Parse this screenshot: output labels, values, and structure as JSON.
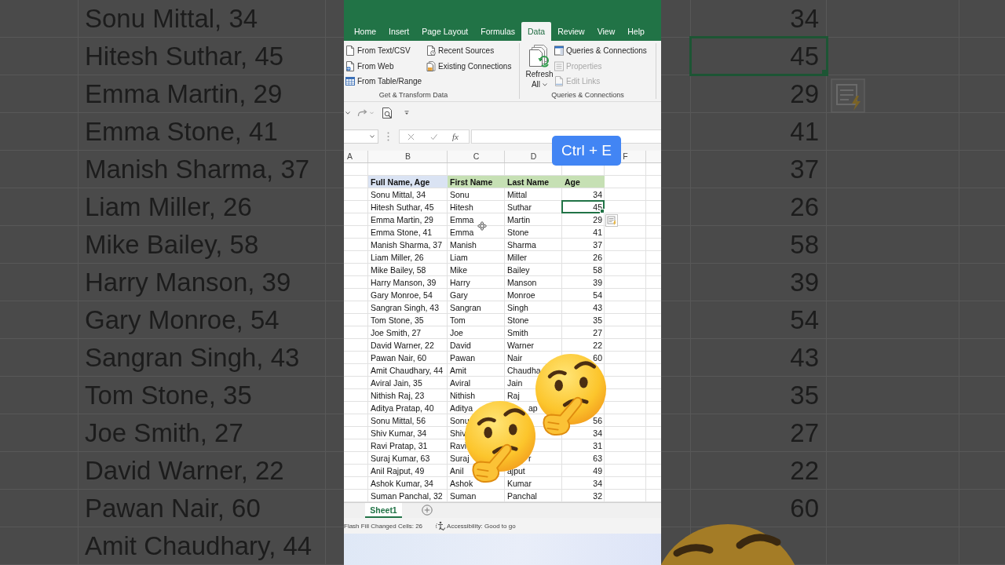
{
  "backdrop_left": {
    "rows": [
      "Sonu Mittal, 34",
      "Hitesh Suthar, 45",
      "Emma Martin, 29",
      "Emma Stone, 41",
      "Manish Sharma, 37",
      "Liam Miller, 26",
      "Mike Bailey, 58",
      "Harry Manson, 39",
      "Gary Monroe, 54",
      "Sangran Singh, 43",
      "Tom Stone, 35",
      "Joe Smith, 27",
      "David Warner, 22",
      "Pawan Nair, 60",
      "Amit Chaudhary, 44"
    ]
  },
  "ribbon": {
    "tabs": [
      {
        "label": "Home",
        "selected": false
      },
      {
        "label": "Insert",
        "selected": false
      },
      {
        "label": "Page Layout",
        "selected": false
      },
      {
        "label": "Formulas",
        "selected": false
      },
      {
        "label": "Data",
        "selected": true
      },
      {
        "label": "Review",
        "selected": false
      },
      {
        "label": "View",
        "selected": false
      },
      {
        "label": "Help",
        "selected": false
      }
    ],
    "groups": [
      {
        "title": "Get & Transform Data",
        "columns": [
          [
            {
              "label": "From Text/CSV",
              "disabled": false
            },
            {
              "label": "From Web",
              "disabled": false
            },
            {
              "label": "From Table/Range",
              "disabled": false
            }
          ],
          [
            {
              "label": "Recent Sources",
              "disabled": false
            },
            {
              "label": "Existing Connections",
              "disabled": false
            }
          ]
        ]
      },
      {
        "title": "Queries & Connections",
        "large_button": {
          "label": "Refresh",
          "sublabel": "All"
        },
        "columns": [
          [
            {
              "label": "Queries & Connections",
              "disabled": false
            },
            {
              "label": "Properties",
              "disabled": true
            },
            {
              "label": "Edit Links",
              "disabled": true
            }
          ]
        ]
      }
    ]
  },
  "formula_bar": {
    "function_label": "fx"
  },
  "shortcut_badge": {
    "text": "Ctrl + E"
  },
  "sheet": {
    "column_headers": [
      "A",
      "B",
      "C",
      "D",
      "F"
    ],
    "table_header": [
      {
        "label": "Full Name, Age",
        "color": "#dae3f3"
      },
      {
        "label": "First Name",
        "color": "#c6e0b4"
      },
      {
        "label": "Last Name",
        "color": "#c6e0b4"
      },
      {
        "label": "Age",
        "color": "#c6e0b4"
      }
    ],
    "rows": [
      {
        "full": "Sonu Mittal, 34",
        "first": "Sonu",
        "last": "Mittal",
        "age": "34",
        "age_selected": false
      },
      {
        "full": "Hitesh Suthar, 45",
        "first": "Hitesh",
        "last": "Suthar",
        "age": "45",
        "age_selected": true
      },
      {
        "full": "Emma Martin, 29",
        "first": "Emma",
        "last": "Martin",
        "age": "29",
        "age_selected": false
      },
      {
        "full": "Emma Stone, 41",
        "first": "Emma",
        "last": "Stone",
        "age": "41",
        "age_selected": false
      },
      {
        "full": "Manish Sharma, 37",
        "first": "Manish",
        "last": "Sharma",
        "age": "37",
        "age_selected": false
      },
      {
        "full": "Liam Miller, 26",
        "first": "Liam",
        "last": "Miller",
        "age": "26",
        "age_selected": false
      },
      {
        "full": "Mike Bailey, 58",
        "first": "Mike",
        "last": "Bailey",
        "age": "58",
        "age_selected": false
      },
      {
        "full": "Harry Manson, 39",
        "first": "Harry",
        "last": "Manson",
        "age": "39",
        "age_selected": false
      },
      {
        "full": "Gary Monroe, 54",
        "first": "Gary",
        "last": "Monroe",
        "age": "54",
        "age_selected": false
      },
      {
        "full": "Sangran Singh, 43",
        "first": "Sangran",
        "last": "Singh",
        "age": "43",
        "age_selected": false
      },
      {
        "full": "Tom Stone, 35",
        "first": "Tom",
        "last": "Stone",
        "age": "35",
        "age_selected": false
      },
      {
        "full": "Joe Smith, 27",
        "first": "Joe",
        "last": "Smith",
        "age": "27",
        "age_selected": false
      },
      {
        "full": "David Warner, 22",
        "first": "David",
        "last": "Warner",
        "age": "22",
        "age_selected": false
      },
      {
        "full": "Pawan Nair, 60",
        "first": "Pawan",
        "last": "Nair",
        "age": "60",
        "age_selected": false
      },
      {
        "full": "Amit Chaudhary, 44",
        "first": "Amit",
        "last": "Chaudha",
        "age_selected": false
      },
      {
        "full": "Aviral Jain, 35",
        "first": "Aviral",
        "last": "Jain",
        "age_selected": false
      },
      {
        "full": "Nithish Raj, 23",
        "first": "Nithish",
        "last": "Raj",
        "age_selected": false
      },
      {
        "full": "Aditya Pratap, 40",
        "first": "Aditya",
        "last_tail": "ap",
        "age_selected": false
      },
      {
        "full": "Sonu Mittal, 56",
        "first": "Sonu",
        "age": "56",
        "age_selected": false
      },
      {
        "full": "Shiv Kumar, 34",
        "first": "Shiv",
        "age": "34",
        "age_selected": false
      },
      {
        "full": "Ravi Pratap, 31",
        "first": "Ravi",
        "age": "31",
        "age_selected": false
      },
      {
        "full": "Suraj Kumar, 63",
        "first": "Suraj",
        "last_tail": "r",
        "age": "63",
        "age_selected": false
      },
      {
        "full": "Anil Rajput, 49",
        "first": "Anil",
        "last": "ajput",
        "age": "49",
        "age_selected": false
      },
      {
        "full": "Ashok Kumar, 34",
        "first": "Ashok",
        "last": "Kumar",
        "age": "34",
        "age_selected": false
      },
      {
        "full": "Suman Panchal, 32",
        "first": "Suman",
        "last": "Panchal",
        "age": "32",
        "age_selected": false
      }
    ]
  },
  "sheet_tabs": [
    {
      "label": "Sheet1",
      "selected": true
    }
  ],
  "status_bar": {
    "message": "Flash Fill Changed Cells: 26",
    "accessibility": "Accessibility: Good to go"
  },
  "backdrop_right": {
    "rows": [
      {
        "age": "34",
        "selected": false
      },
      {
        "age": "45",
        "selected": true
      },
      {
        "age": "29",
        "selected": false
      },
      {
        "age": "41",
        "selected": false
      },
      {
        "age": "37",
        "selected": false
      },
      {
        "age": "26",
        "selected": false
      },
      {
        "age": "58",
        "selected": false
      },
      {
        "age": "39",
        "selected": false
      },
      {
        "age": "54",
        "selected": false
      },
      {
        "age": "43",
        "selected": false
      },
      {
        "age": "35",
        "selected": false
      },
      {
        "age": "27",
        "selected": false
      },
      {
        "age": "22",
        "selected": false
      },
      {
        "age": "60",
        "selected": false
      }
    ]
  }
}
